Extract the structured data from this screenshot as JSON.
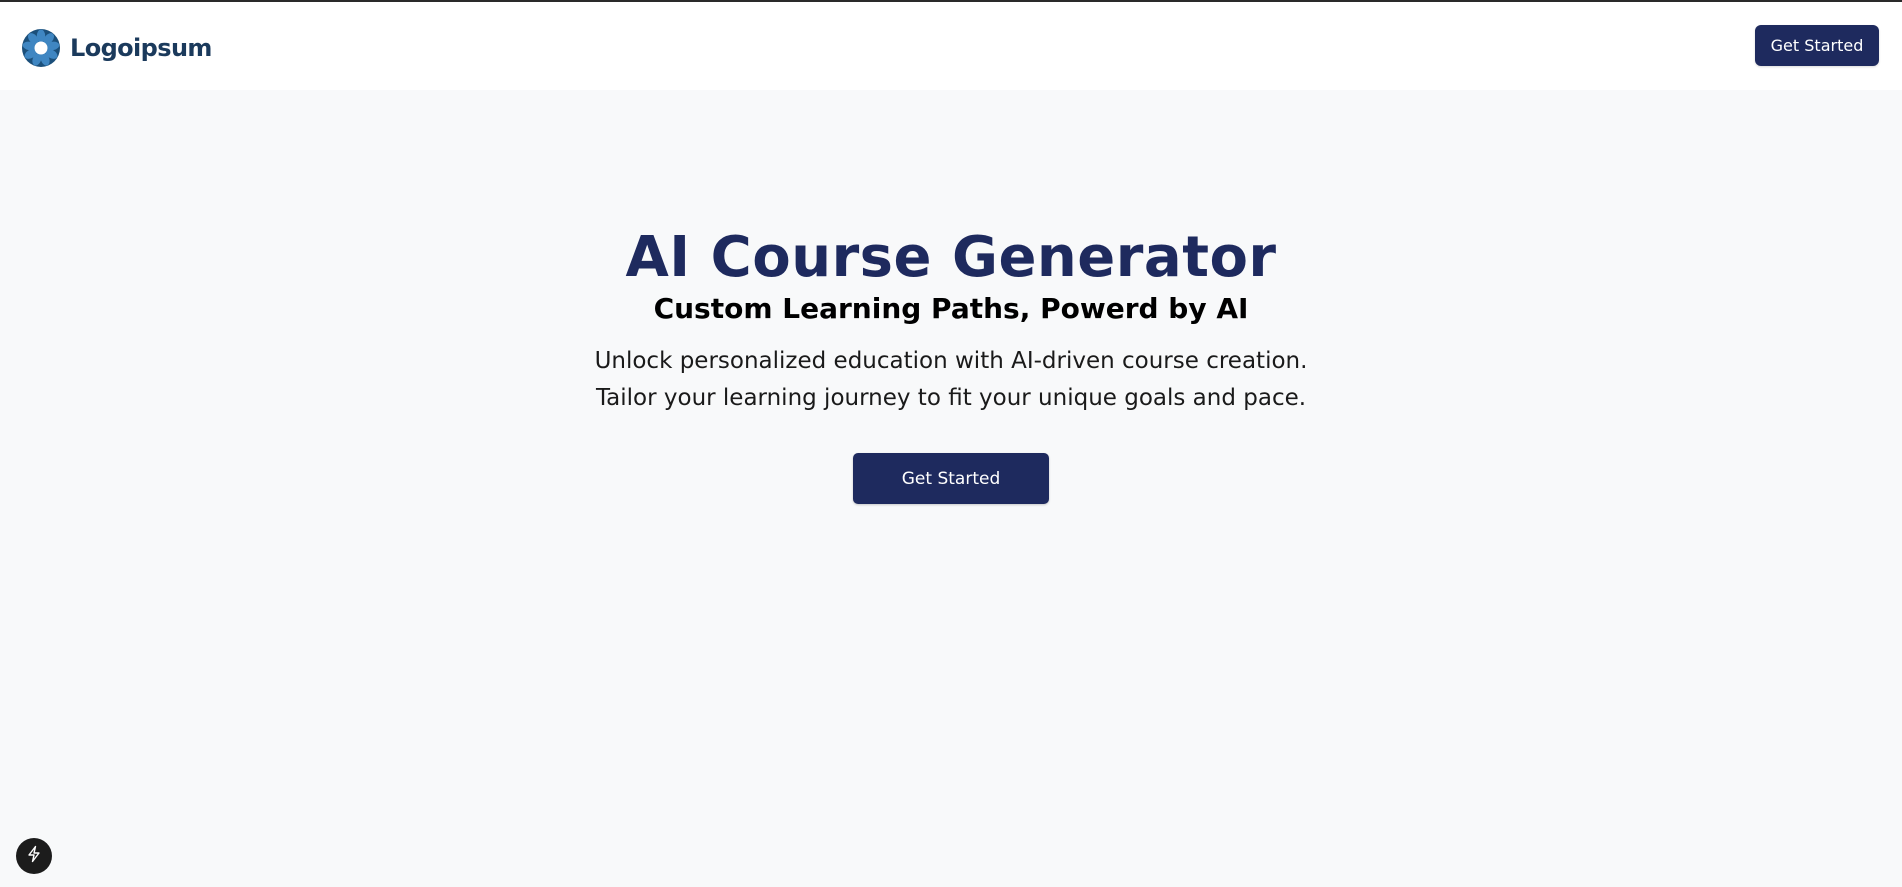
{
  "header": {
    "logo_text": "Logoipsum",
    "cta_label": "Get Started"
  },
  "hero": {
    "title": "AI Course Generator",
    "subtitle": "Custom Learning Paths, Powerd by AI",
    "description_line1": "Unlock personalized education with AI-driven course creation.",
    "description_line2": "Tailor your learning journey to fit your unique goals and pace.",
    "cta_label": "Get Started"
  },
  "icons": {
    "logo": "logo-icon",
    "dev_badge": "lightning-icon"
  },
  "colors": {
    "brand_navy": "#1e2a5e",
    "logo_blue": "#1b3a5c",
    "page_background": "#f8f9fa",
    "header_background": "#ffffff"
  }
}
